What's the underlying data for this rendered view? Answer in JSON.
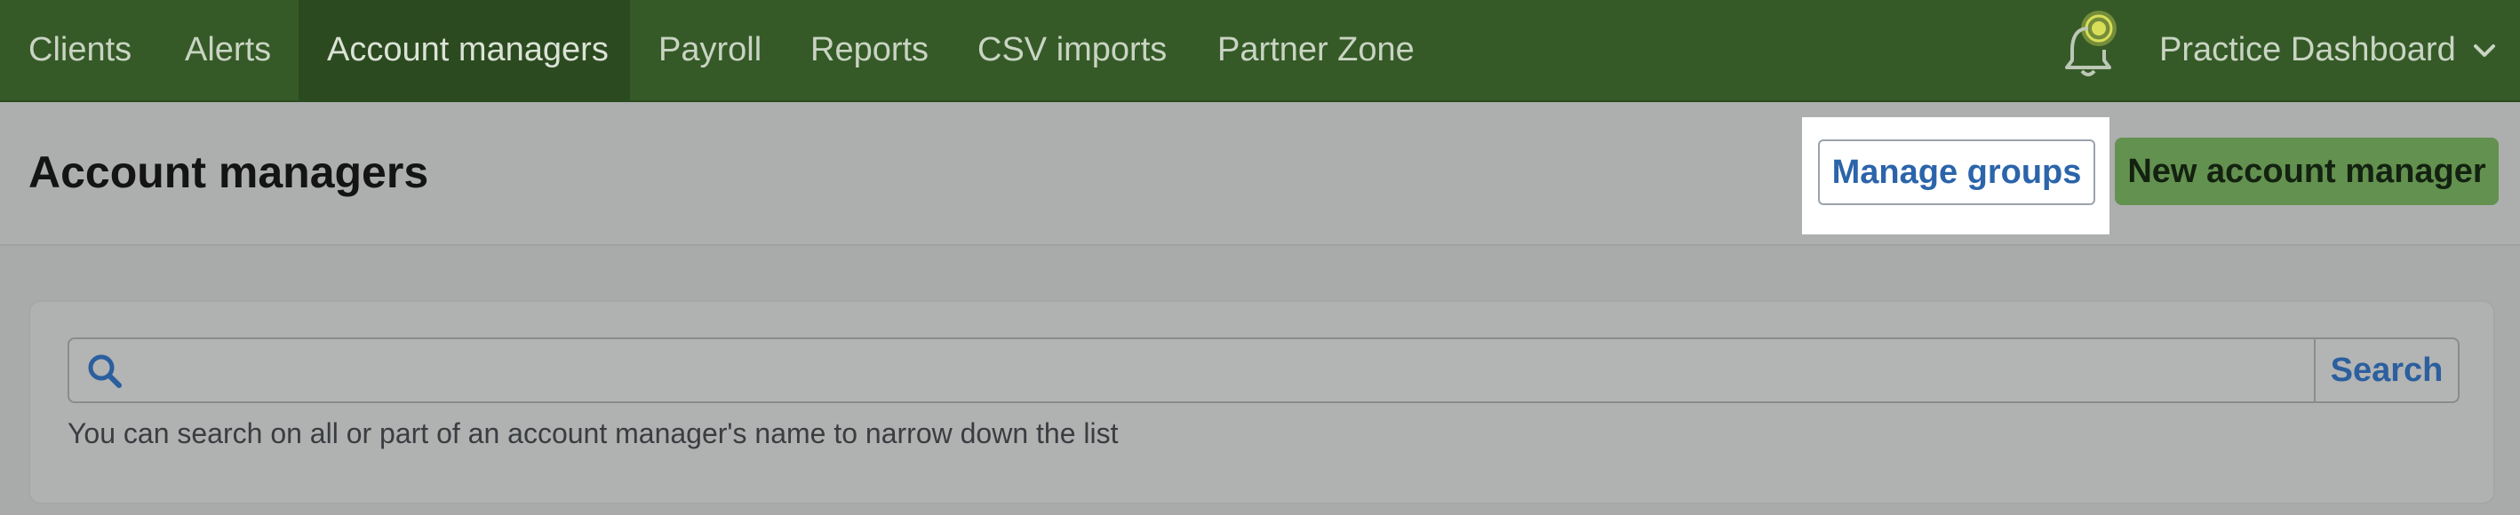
{
  "nav": {
    "items": [
      {
        "label": "Clients"
      },
      {
        "label": "Alerts"
      },
      {
        "label": "Account managers",
        "active": true
      },
      {
        "label": "Payroll"
      },
      {
        "label": "Reports"
      },
      {
        "label": "CSV imports"
      },
      {
        "label": "Partner Zone"
      }
    ],
    "notification_icon": "bell-icon",
    "practice_label": "Practice Dashboard",
    "dropdown_icon": "chevron-down-icon"
  },
  "header": {
    "title": "Account managers",
    "manage_groups_label": "Manage groups",
    "new_manager_label": "New account manager"
  },
  "search": {
    "value": "",
    "button_label": "Search",
    "hint": "You can search on all or part of an account manager's name to narrow down the list"
  },
  "colors": {
    "nav_bg": "#355a27",
    "primary_button": "#63914f",
    "link_blue": "#2b64aa"
  }
}
